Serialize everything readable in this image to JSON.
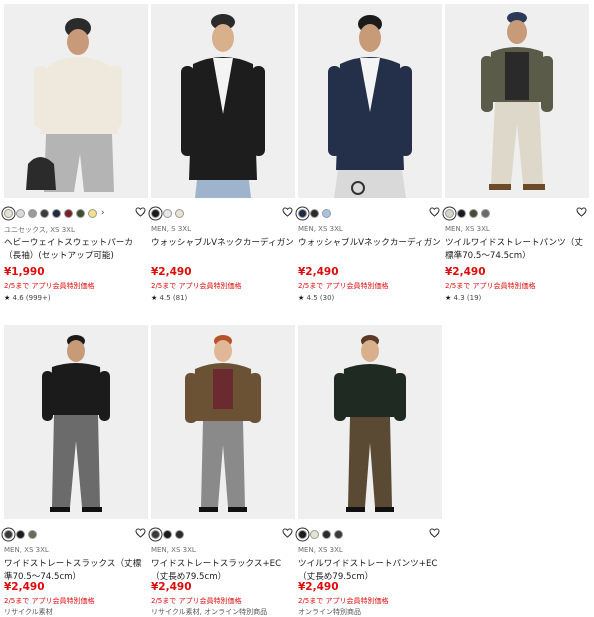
{
  "products": [
    {
      "colors": [
        "#e8e2d2",
        "#d9d9d9",
        "#9a9a9a",
        "#3a3a3a",
        "#1f2a44",
        "#7a1f2b",
        "#3e4e2f",
        "#f3e08a"
      ],
      "has_more": true,
      "more_label": "›",
      "sizes": "ユニセックス, XS 3XL",
      "name": "ヘビーウェイトスウェットパーカ（長袖）(セットアップ可能)",
      "price": "¥1,990",
      "promo": "2/5まで アプリ会員特別価格",
      "rating_star": "★",
      "rating": "4.6",
      "reviews": "(999+)",
      "note": ""
    },
    {
      "colors": [
        "#1b1b1b",
        "#e8e8e8",
        "#e8e2d2"
      ],
      "has_more": false,
      "sizes": "MEN, S 3XL",
      "name": "ウォッシャブルVネックカーディガン",
      "price": "¥2,490",
      "promo": "2/5まで アプリ会員特別価格",
      "rating_star": "★",
      "rating": "4.5",
      "reviews": "(81)",
      "note": ""
    },
    {
      "colors": [
        "#1f2a44",
        "#2b2b2b",
        "#a9c3e6"
      ],
      "has_more": false,
      "sizes": "MEN, XS 3XL",
      "name": "ウォッシャブルVネックカーディガン",
      "price": "¥2,490",
      "promo": "2/5まで アプリ会員特別価格",
      "rating_star": "★",
      "rating": "4.5",
      "reviews": "(30)",
      "note": ""
    },
    {
      "colors": [
        "#d8d3c4",
        "#1b1b1b",
        "#4a4a3a",
        "#6b6b6b"
      ],
      "has_more": false,
      "sizes": "MEN, XS 3XL",
      "name": "ツイルワイドストレートパンツ（丈標準70.5～74.5cm）",
      "price": "¥2,490",
      "promo": "2/5まで アプリ会員特別価格",
      "rating_star": "★",
      "rating": "4.3",
      "reviews": "(19)",
      "note": ""
    },
    {
      "colors": [
        "#3a3a3a",
        "#1b1b1b",
        "#6a6a5a"
      ],
      "has_more": false,
      "sizes": "MEN, XS 3XL",
      "name": "ワイドストレートスラックス（丈標準70.5～74.5cm）",
      "price": "¥2,490",
      "promo": "2/5まで アプリ会員特別価格",
      "rating_star": "",
      "rating": "",
      "reviews": "",
      "note": "リサイクル素材"
    },
    {
      "colors": [
        "#3a3a3a",
        "#1b1b1b",
        "#2b2b2b"
      ],
      "has_more": false,
      "sizes": "MEN, XS 3XL",
      "name": "ワイドストレートスラックス+EC（丈長め79.5cm）",
      "price": "¥2,490",
      "promo": "2/5まで アプリ会員特別価格",
      "rating_star": "",
      "rating": "",
      "reviews": "",
      "note": "リサイクル素材, オンライン特別商品"
    },
    {
      "colors": [
        "#1b1b1b",
        "#e8e2d2",
        "#2b2b2b",
        "#3a3a3a"
      ],
      "has_more": false,
      "sizes": "MEN, XS 3XL",
      "name": "ツイルワイドストレートパンツ+EC（丈長め79.5cm）",
      "price": "¥2,490",
      "promo": "2/5まで アプリ会員特別価格",
      "rating_star": "",
      "rating": "",
      "reviews": "",
      "note": "オンライン特別商品"
    }
  ]
}
